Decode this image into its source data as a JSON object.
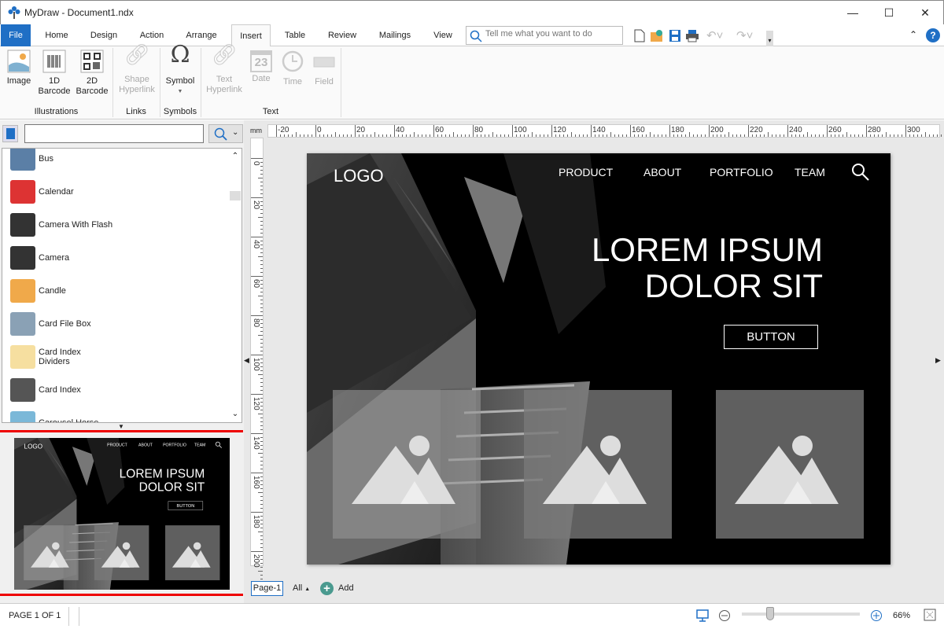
{
  "window": {
    "title": "MyDraw - Document1.ndx",
    "minimize": "—",
    "maximize": "☐",
    "close": "✕"
  },
  "tabs": [
    {
      "label": "File"
    },
    {
      "label": "Home"
    },
    {
      "label": "Design"
    },
    {
      "label": "Action"
    },
    {
      "label": "Arrange"
    },
    {
      "label": "Insert",
      "active": true
    },
    {
      "label": "Table"
    },
    {
      "label": "Review"
    },
    {
      "label": "Mailings"
    },
    {
      "label": "View"
    }
  ],
  "tell_me": {
    "placeholder": "Tell me what you want to do"
  },
  "ribbon": {
    "buttons": [
      {
        "label": "Image"
      },
      {
        "label": "1D\nBarcode"
      },
      {
        "label": "2D\nBarcode"
      },
      {
        "label": "Shape\nHyperlink",
        "disabled": true
      },
      {
        "label": "Symbol"
      },
      {
        "label": "Text\nHyperlink",
        "disabled": true
      },
      {
        "label": "Date",
        "disabled": true
      },
      {
        "label": "Time",
        "disabled": true
      },
      {
        "label": "Field",
        "disabled": true
      }
    ],
    "groups": [
      {
        "label": "Illustrations"
      },
      {
        "label": "Links"
      },
      {
        "label": "Symbols"
      },
      {
        "label": "Text"
      }
    ],
    "date_icon_number": "23"
  },
  "shapes_panel": {
    "search_value": "",
    "items": [
      {
        "label": "Bus",
        "color": "#5b7fa6"
      },
      {
        "label": "Calendar",
        "color": "#d33"
      },
      {
        "label": "Camera With Flash",
        "color": "#333"
      },
      {
        "label": "Camera",
        "color": "#333"
      },
      {
        "label": "Candle",
        "color": "#f0a94a"
      },
      {
        "label": "Card File Box",
        "color": "#8aa1b5"
      },
      {
        "label": "Card Index\nDividers",
        "color": "#f6dfa0"
      },
      {
        "label": "Card Index",
        "color": "#555"
      },
      {
        "label": "Carousel Horse",
        "color": "#7bb8d8"
      }
    ]
  },
  "ruler": {
    "unit": "mm",
    "h_labels": [
      "-20",
      "0",
      "20",
      "40",
      "60",
      "80",
      "100",
      "120",
      "140",
      "160",
      "180",
      "200",
      "220",
      "240",
      "260",
      "280",
      "300"
    ],
    "v_labels": [
      "0",
      "20",
      "40",
      "60",
      "80",
      "100",
      "120",
      "140",
      "160",
      "180",
      "200"
    ]
  },
  "document": {
    "logo": "LOGO",
    "nav": [
      "PRODUCT",
      "ABOUT",
      "PORTFOLIO",
      "TEAM"
    ],
    "headline1": "LOREM IPSUM",
    "headline2": "DOLOR SIT",
    "button": "BUTTON"
  },
  "page_tabs": {
    "current": "Page-1",
    "all": "All",
    "add": "Add"
  },
  "status": {
    "page": "PAGE 1 OF 1",
    "zoom": "66%",
    "zoom_level": 0.24
  }
}
